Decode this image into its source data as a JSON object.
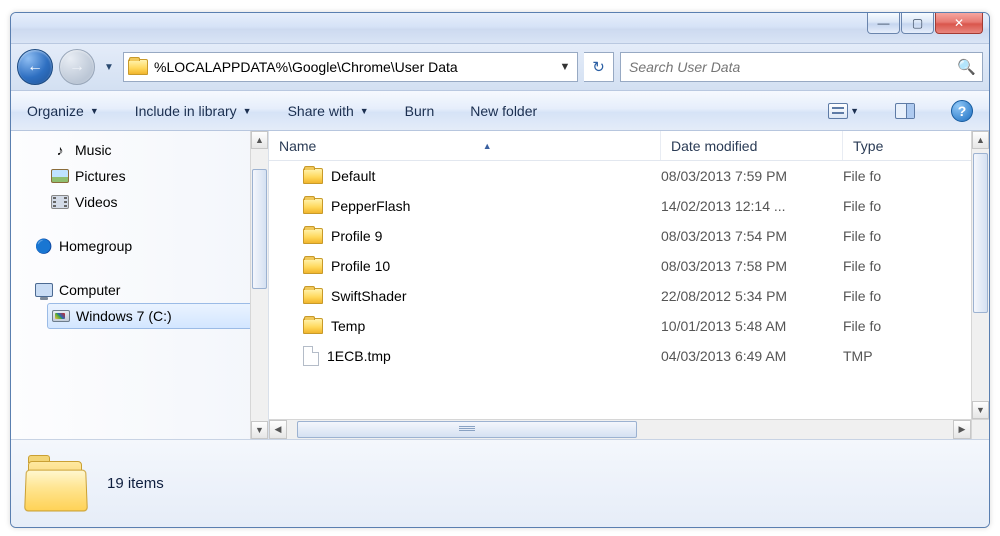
{
  "address": {
    "path": "%LOCALAPPDATA%\\Google\\Chrome\\User Data"
  },
  "search": {
    "placeholder": "Search User Data"
  },
  "toolbar": {
    "organize": "Organize",
    "include": "Include in library",
    "share": "Share with",
    "burn": "Burn",
    "newfolder": "New folder"
  },
  "sidebar": {
    "music": "Music",
    "pictures": "Pictures",
    "videos": "Videos",
    "homegroup": "Homegroup",
    "computer": "Computer",
    "drive_c": "Windows 7 (C:)"
  },
  "columns": {
    "name": "Name",
    "date": "Date modified",
    "type": "Type"
  },
  "files": [
    {
      "icon": "folder",
      "name": "Default",
      "date": "08/03/2013 7:59 PM",
      "type": "File fo"
    },
    {
      "icon": "folder",
      "name": "PepperFlash",
      "date": "14/02/2013 12:14 ...",
      "type": "File fo"
    },
    {
      "icon": "folder",
      "name": "Profile 9",
      "date": "08/03/2013 7:54 PM",
      "type": "File fo"
    },
    {
      "icon": "folder",
      "name": "Profile 10",
      "date": "08/03/2013 7:58 PM",
      "type": "File fo"
    },
    {
      "icon": "folder",
      "name": "SwiftShader",
      "date": "22/08/2012 5:34 PM",
      "type": "File fo"
    },
    {
      "icon": "folder",
      "name": "Temp",
      "date": "10/01/2013 5:48 AM",
      "type": "File fo"
    },
    {
      "icon": "file",
      "name": "1ECB.tmp",
      "date": "04/03/2013 6:49 AM",
      "type": "TMP"
    }
  ],
  "status": {
    "items_label": "19 items"
  }
}
